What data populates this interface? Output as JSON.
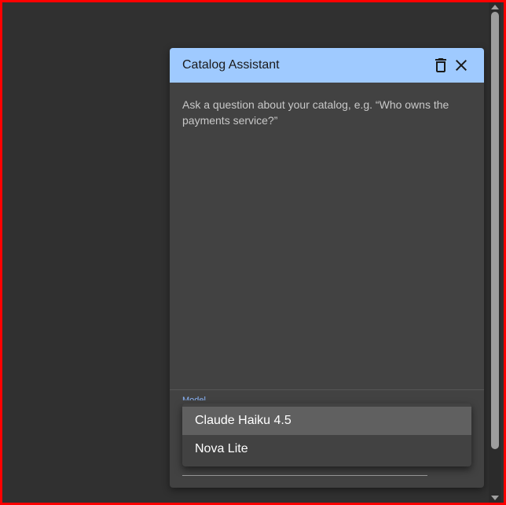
{
  "panel": {
    "title": "Catalog Assistant",
    "hint": "Ask a question about your catalog, e.g. “Who owns the payments service?”",
    "delete_icon": "delete-icon",
    "close_icon": "close-icon"
  },
  "model_select": {
    "label": "Model",
    "options": [
      {
        "label": "Claude Haiku 4.5",
        "selected": true
      },
      {
        "label": "Nova Lite",
        "selected": false
      }
    ]
  },
  "colors": {
    "header": "#9fcaff",
    "panel": "#424242",
    "background": "#303030",
    "selected_option": "#606060",
    "label_accent": "#8ab4f8"
  }
}
